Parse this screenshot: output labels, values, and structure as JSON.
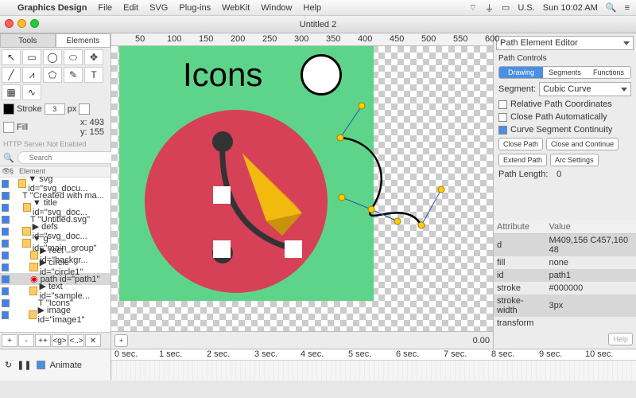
{
  "menubar": {
    "apple": "",
    "app": "Graphics Design",
    "items": [
      "File",
      "Edit",
      "SVG",
      "Plug-ins",
      "WebKit",
      "Window",
      "Help"
    ],
    "locale": "U.S.",
    "time": "Sun 10:02 AM"
  },
  "window": {
    "title": "Untitled 2"
  },
  "left": {
    "tabs": [
      "Tools",
      "Elements"
    ],
    "stroke_label": "Stroke",
    "stroke_val": "3",
    "stroke_unit": "px",
    "fill_label": "Fill",
    "x": "x: 493",
    "y": "y: 155",
    "server": "HTTP Server Not Enabled",
    "search_ph": "Search",
    "tree_header": [
      "§",
      "Element"
    ],
    "tree": [
      "▼ svg id=\"svg_docu...",
      "\"Created with ma...",
      "▼ title id=\"svg_doc...",
      "\"Untitled.svg\"",
      "▶ defs id=\"svg_doc...",
      "▼ g id=\"main_group\"",
      "▶ rect id=\"backgr...",
      "▶ circle id=\"circle1\"",
      "path id=\"path1\"",
      "▶ text id=\"sample...",
      "\"Icons\"",
      "▶ image id=\"image1\""
    ],
    "btns": [
      "+",
      "-",
      "++",
      "<g>",
      "<..>",
      "✕"
    ]
  },
  "canvas": {
    "title": "Icons",
    "ruler": [
      "50",
      "100",
      "150",
      "200",
      "250",
      "300",
      "350",
      "400",
      "450",
      "500",
      "550",
      "600"
    ]
  },
  "right": {
    "panel": "Path Element Editor",
    "title": "Path Controls",
    "tabs": [
      "Drawing",
      "Segments",
      "Functions"
    ],
    "seg_label": "Segment:",
    "seg_val": "Cubic Curve",
    "opts": [
      "Relative Path Coordinates",
      "Close Path Automatically",
      "Curve Segment Continuity"
    ],
    "checked": [
      false,
      false,
      true
    ],
    "btns": [
      "Close Path",
      "Close and Continue",
      "Extend Path",
      "Arc Settings"
    ],
    "len_label": "Path Length:",
    "len_val": "0",
    "attrs_h": [
      "Attribute",
      "Value"
    ],
    "attrs": [
      [
        "d",
        "M409,156 C457,160 48"
      ],
      [
        "fill",
        "none"
      ],
      [
        "id",
        "path1"
      ],
      [
        "stroke",
        "#000000"
      ],
      [
        "stroke-width",
        "3px"
      ],
      [
        "transform",
        ""
      ]
    ],
    "help": "Help"
  },
  "bottom": {
    "add": "+",
    "val": "0.00"
  },
  "timeline": {
    "animate": "Animate",
    "ticks": [
      "0 sec.",
      "1 sec.",
      "2 sec.",
      "3 sec.",
      "4 sec.",
      "5 sec.",
      "6 sec.",
      "7 sec.",
      "8 sec.",
      "9 sec.",
      "10 sec."
    ]
  },
  "chart_data": null
}
